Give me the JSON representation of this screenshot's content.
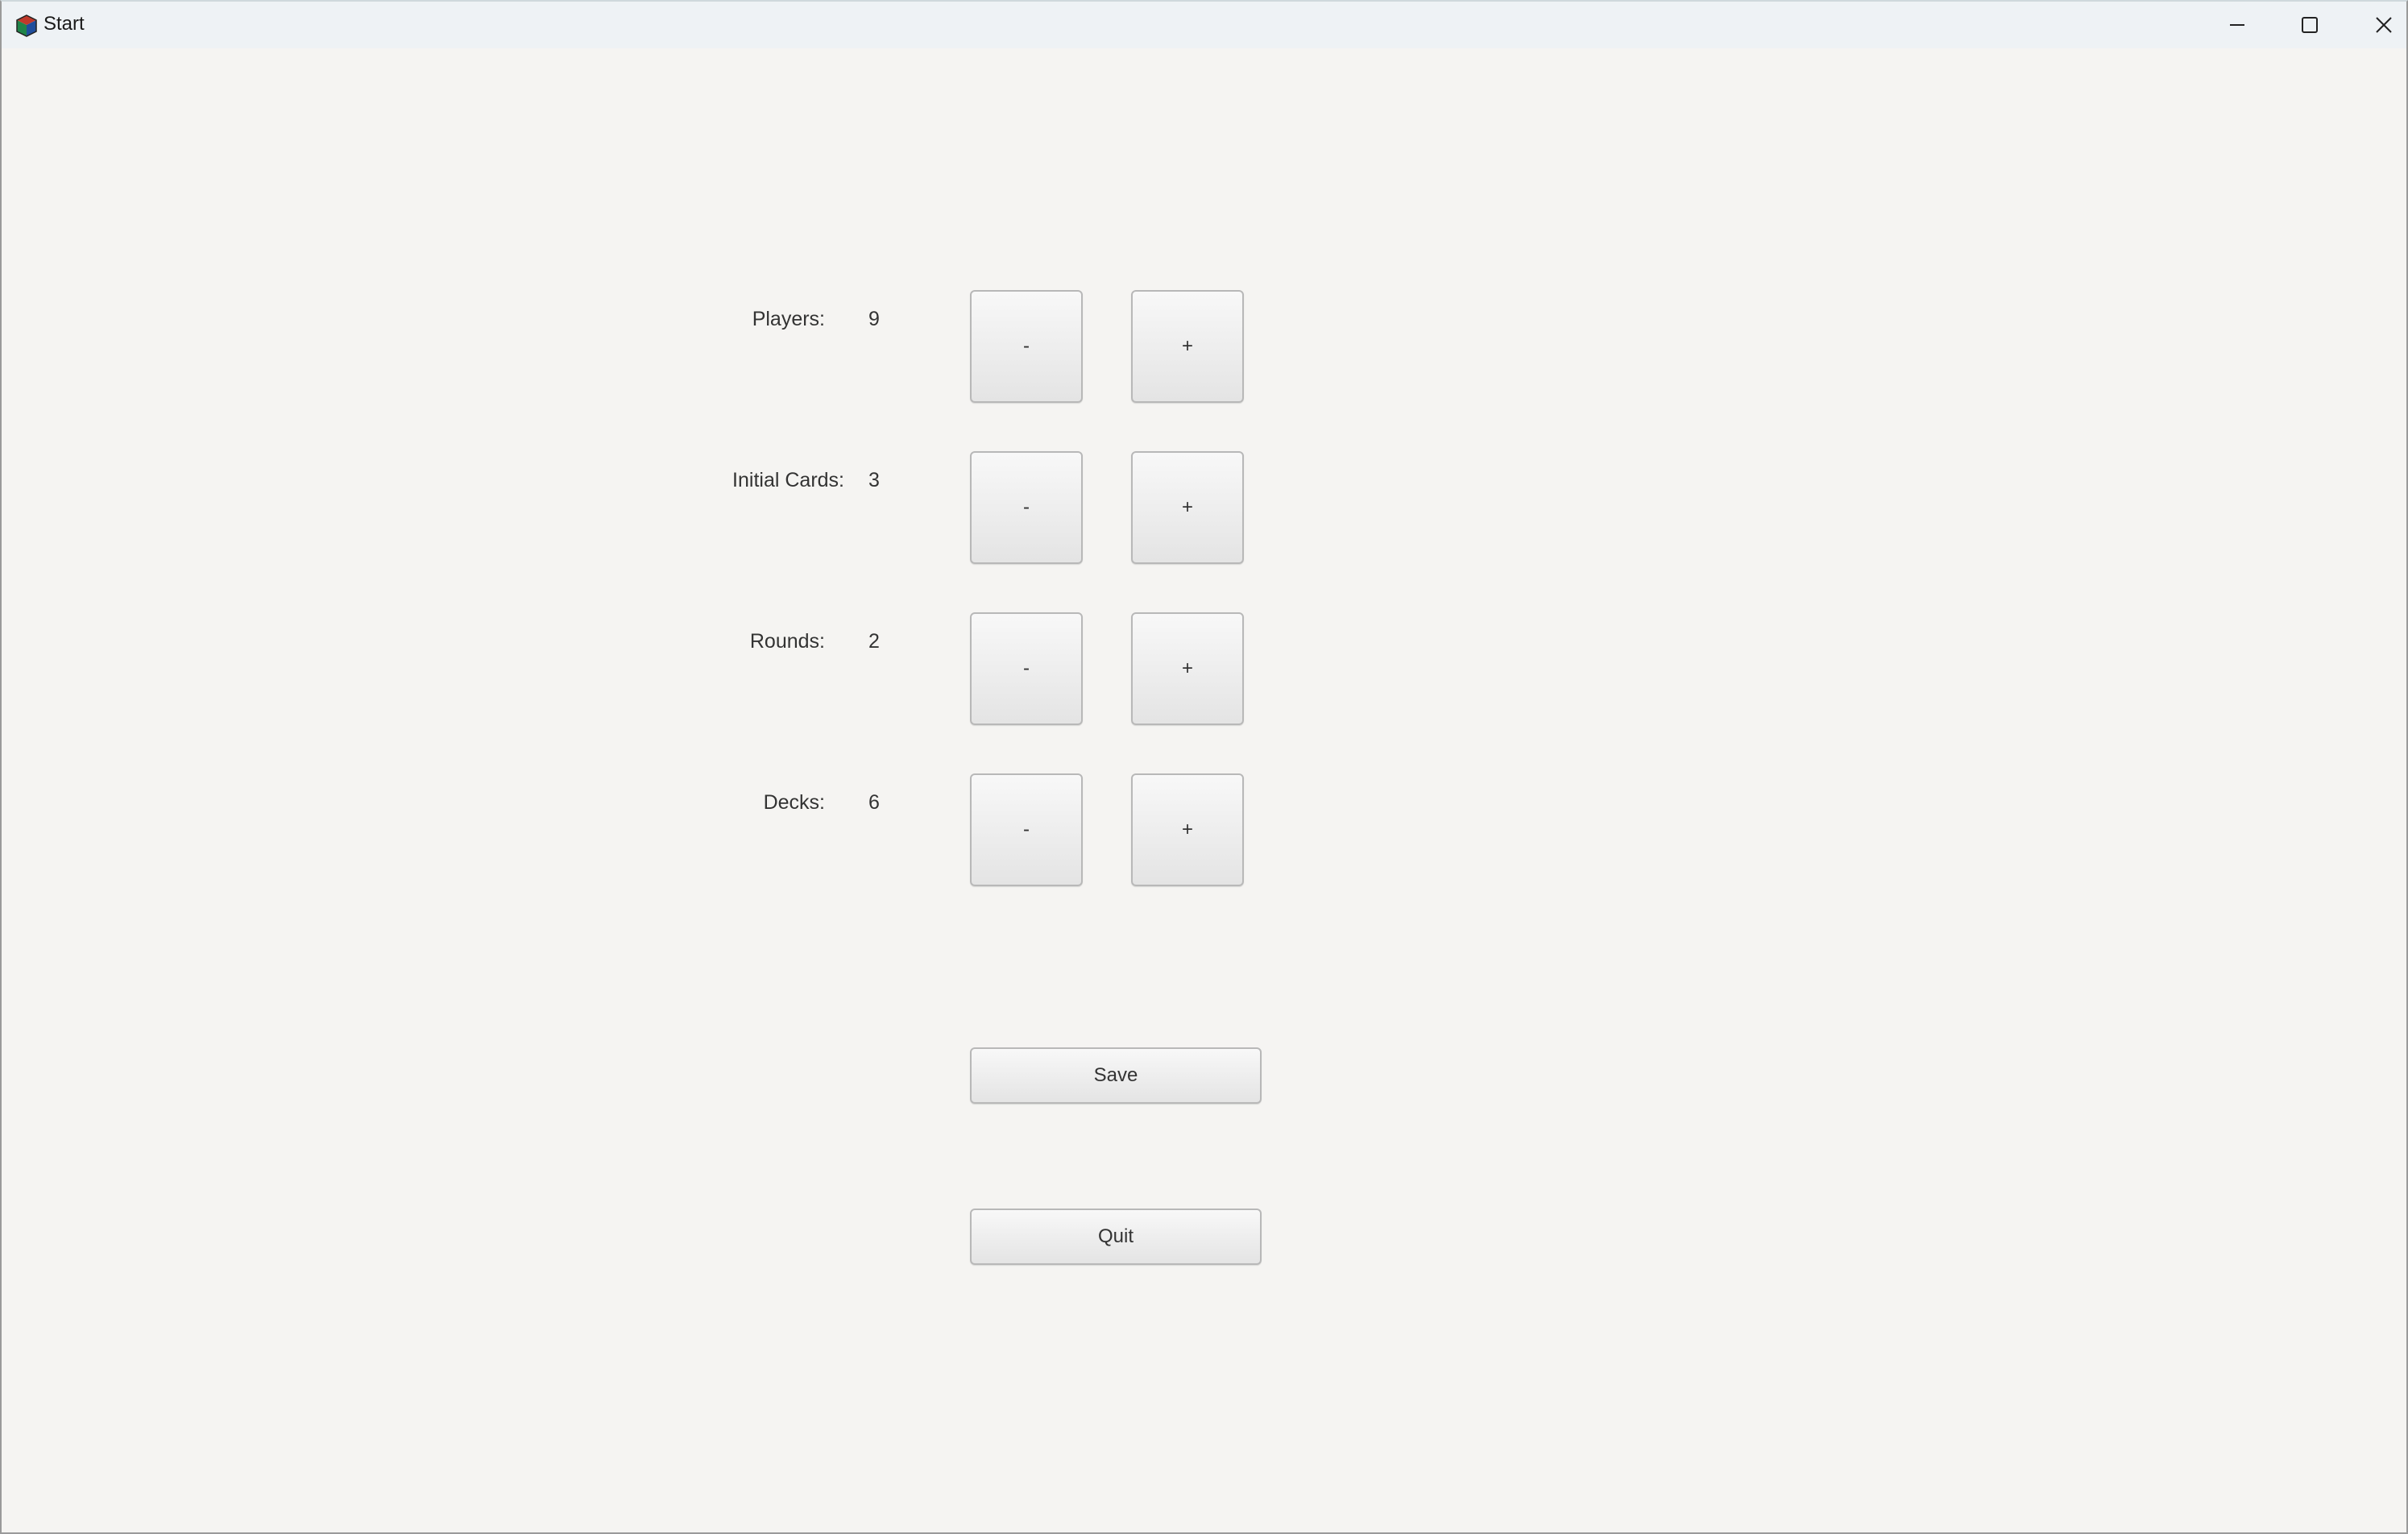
{
  "window": {
    "title": "Start",
    "controls": {
      "minimize_icon": "minimize-icon",
      "maximize_icon": "maximize-icon",
      "close_icon": "close-icon"
    }
  },
  "settings": [
    {
      "label": "Players:",
      "value": "9",
      "minus": "-",
      "plus": "+"
    },
    {
      "label": "Initial Cards:",
      "value": "3",
      "minus": "-",
      "plus": "+"
    },
    {
      "label": "Rounds:",
      "value": "2",
      "minus": "-",
      "plus": "+"
    },
    {
      "label": "Decks:",
      "value": "6",
      "minus": "-",
      "plus": "+"
    }
  ],
  "actions": {
    "save_label": "Save",
    "quit_label": "Quit"
  },
  "colors": {
    "background": "#f5f4f2",
    "titlebar": "#eef2f5",
    "button_border": "#b8b8b8"
  }
}
